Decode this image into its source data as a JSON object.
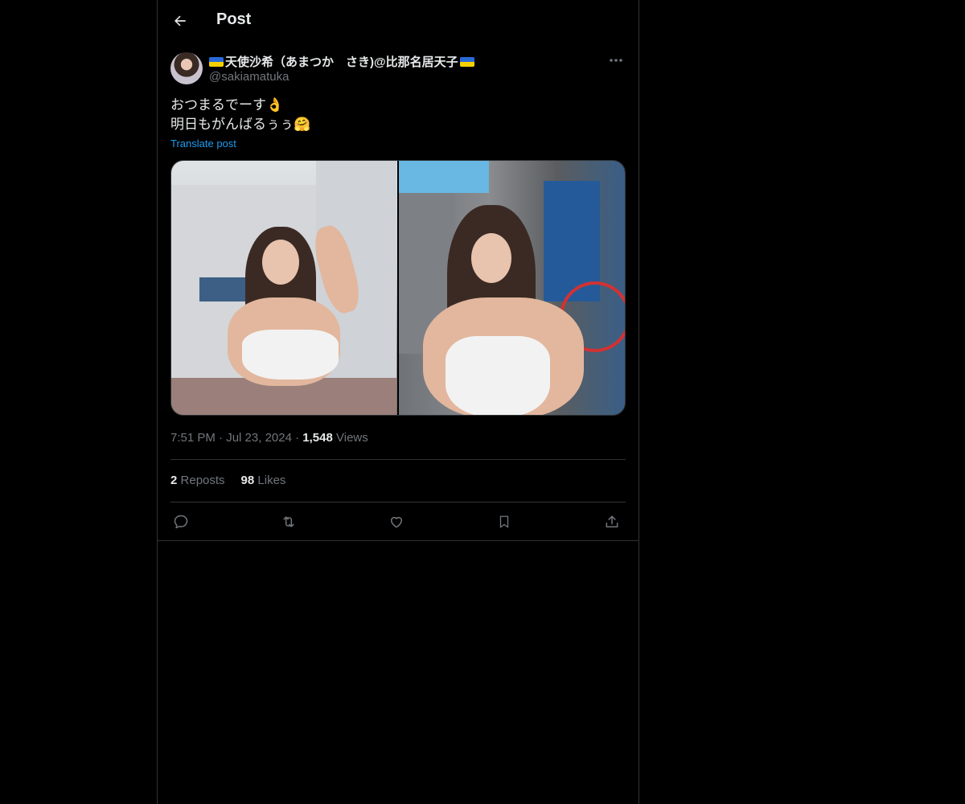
{
  "header": {
    "title": "Post"
  },
  "author": {
    "name_before_flag": "",
    "name": "天使沙希（あまつか　さき)@比那名居天子",
    "handle": "@sakiamatuka"
  },
  "post": {
    "text_line1": "おつまるでーす👌",
    "text_line2": "明日もがんばるぅぅ🤗",
    "translate_label": "Translate post"
  },
  "meta": {
    "time": "7:51 PM",
    "separator": "·",
    "date": "Jul 23, 2024",
    "views_count": "1,548",
    "views_label": "Views"
  },
  "stats": {
    "reposts_count": "2",
    "reposts_label": "Reposts",
    "likes_count": "98",
    "likes_label": "Likes"
  },
  "icons": {
    "back": "arrow-left-icon",
    "more": "more-horizontal-icon",
    "reply": "reply-icon",
    "repost": "repost-icon",
    "like": "heart-icon",
    "bookmark": "bookmark-icon",
    "share": "share-icon",
    "flag": "ukraine-flag-icon"
  },
  "colors": {
    "background": "#000000",
    "text_primary": "#e7e9ea",
    "text_secondary": "#71767b",
    "link": "#1d9bf0",
    "border": "#2f3336"
  }
}
